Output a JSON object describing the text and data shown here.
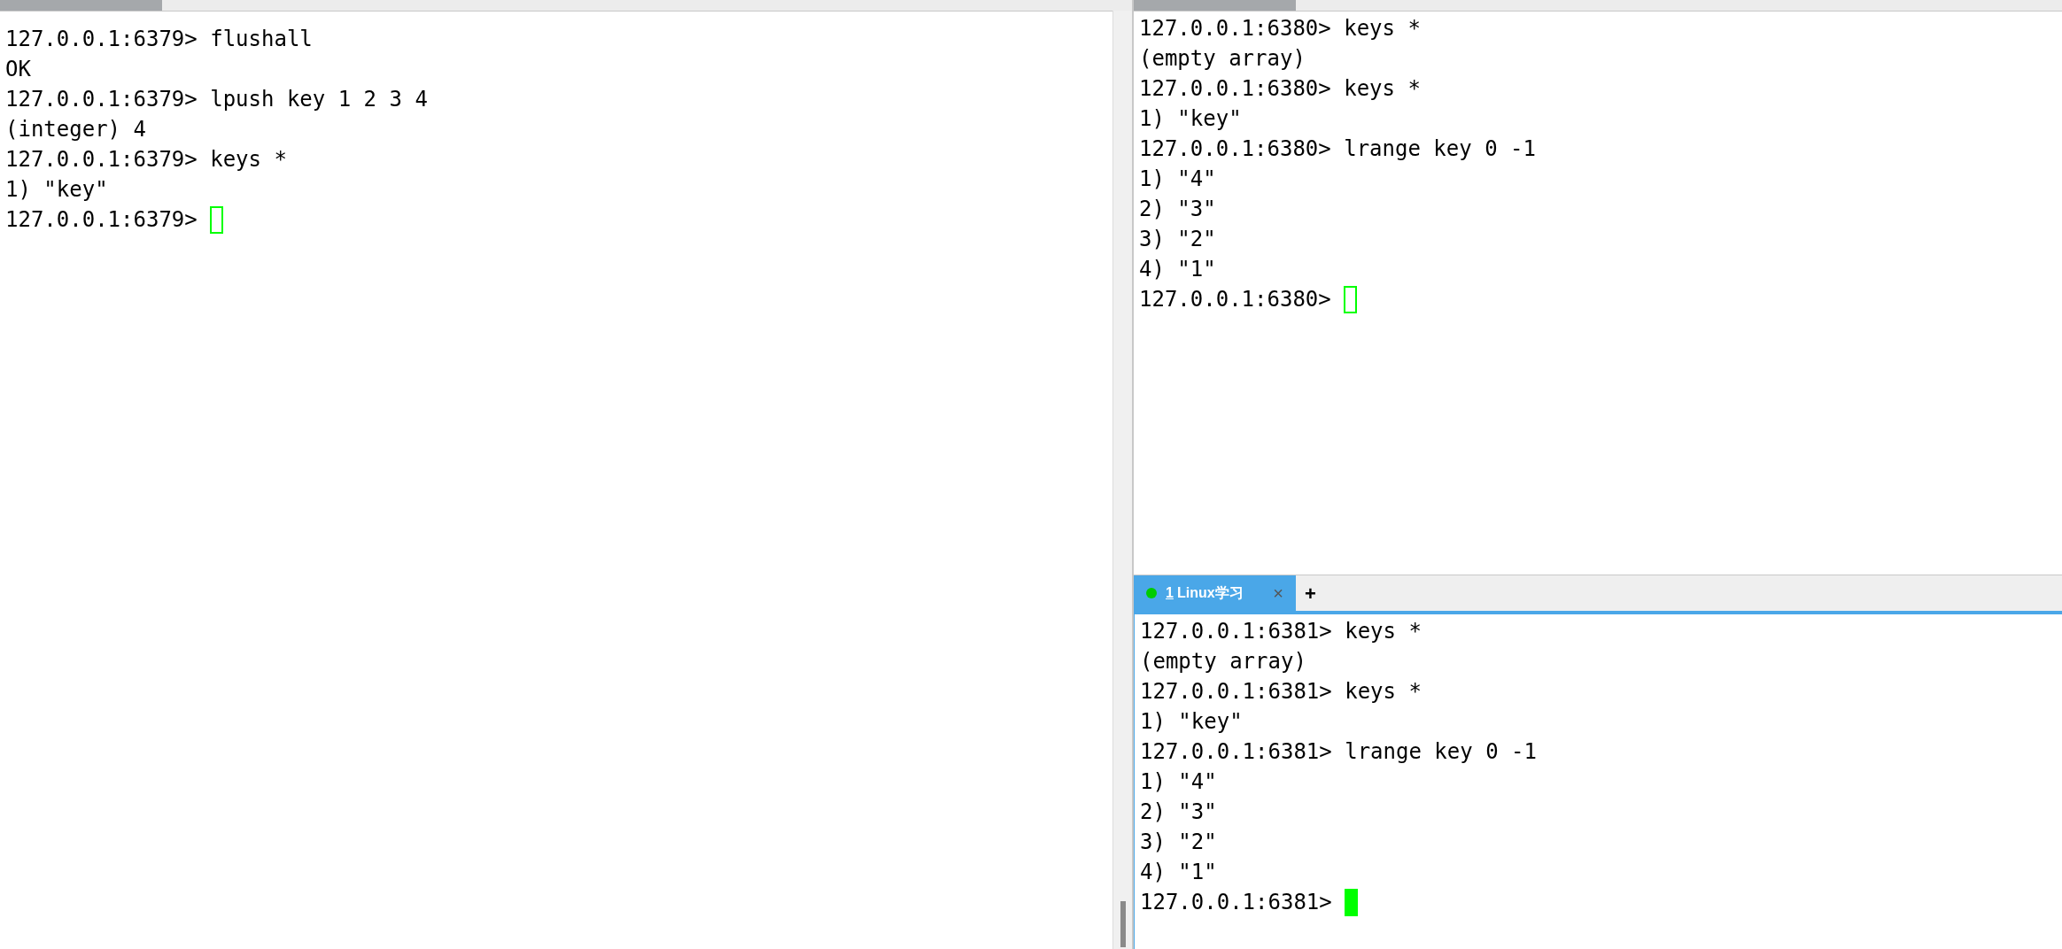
{
  "left_pane": {
    "lines": [
      "127.0.0.1:6379> flushall",
      "OK",
      "127.0.0.1:6379> lpush key 1 2 3 4",
      "(integer) 4",
      "127.0.0.1:6379> keys *",
      "1) \"key\"",
      "127.0.0.1:6379> "
    ],
    "cursor_filled": false
  },
  "top_right_pane": {
    "lines": [
      "127.0.0.1:6380> keys *",
      "(empty array)",
      "127.0.0.1:6380> keys *",
      "1) \"key\"",
      "127.0.0.1:6380> lrange key 0 -1",
      "1) \"4\"",
      "2) \"3\"",
      "3) \"2\"",
      "4) \"1\"",
      "127.0.0.1:6380> "
    ],
    "cursor_filled": false
  },
  "tabs": [
    {
      "number": "1",
      "label": "Linux学习",
      "close": "×",
      "selected": true,
      "color": "#00cc00"
    }
  ],
  "new_tab": "+",
  "bottom_right_pane": {
    "lines": [
      "127.0.0.1:6381> keys *",
      "(empty array)",
      "127.0.0.1:6381> keys *",
      "1) \"key\"",
      "127.0.0.1:6381> lrange key 0 -1",
      "1) \"4\"",
      "2) \"3\"",
      "3) \"2\"",
      "4) \"1\"",
      "127.0.0.1:6381> "
    ],
    "cursor_filled": true
  }
}
